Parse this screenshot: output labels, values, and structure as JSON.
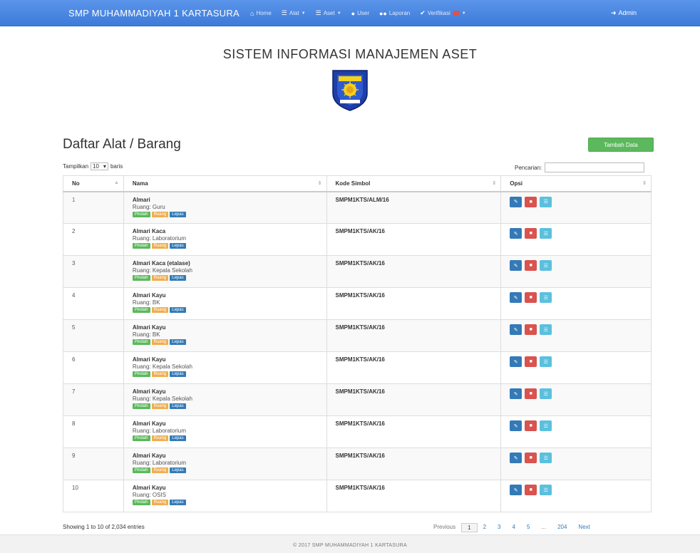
{
  "navbar": {
    "brand": "SMP MUHAMMADIYAH 1 KARTASURA",
    "items": [
      {
        "label": "Home",
        "icon": "home-icon"
      },
      {
        "label": "Alat",
        "icon": "list-icon"
      },
      {
        "label": "Aset",
        "icon": "list-icon"
      },
      {
        "label": "User",
        "icon": "user-icon"
      },
      {
        "label": "Laporan",
        "icon": "users-icon"
      },
      {
        "label": "Verifikasi",
        "icon": "check-icon"
      }
    ],
    "admin_label": "Admin"
  },
  "header": {
    "title": "SISTEM INFORMASI MANAJEMEN ASET"
  },
  "page": {
    "title": "Daftar Alat / Barang",
    "add_button": "Tambah Data"
  },
  "table_controls": {
    "length_prefix": "Tampilkan",
    "length_value": "10",
    "length_suffix": "baris",
    "search_label": "Pencarian:"
  },
  "columns": [
    "No",
    "Nama",
    "Kode Simbol",
    "Opsi"
  ],
  "tag_labels": {
    "pindah": "Pindah",
    "ruang": "Ruang",
    "lepas": "Lepas"
  },
  "rows": [
    {
      "no": "1",
      "name": "Almari",
      "room": "Ruang: Guru",
      "code": "SMPM1KTS/ALM/16"
    },
    {
      "no": "2",
      "name": "Almari Kaca",
      "room": "Ruang: Laboratorium",
      "code": "SMPM1KTS/AK/16"
    },
    {
      "no": "3",
      "name": "Almari Kaca (etalase)",
      "room": "Ruang: Kepala Sekolah",
      "code": "SMPM1KTS/AK/16"
    },
    {
      "no": "4",
      "name": "Almari Kayu",
      "room": "Ruang: BK",
      "code": "SMPM1KTS/AK/16"
    },
    {
      "no": "5",
      "name": "Almari Kayu",
      "room": "Ruang: BK",
      "code": "SMPM1KTS/AK/16"
    },
    {
      "no": "6",
      "name": "Almari Kayu",
      "room": "Ruang: Kepala Sekolah",
      "code": "SMPM1KTS/AK/16"
    },
    {
      "no": "7",
      "name": "Almari Kayu",
      "room": "Ruang: Kepala Sekolah",
      "code": "SMPM1KTS/AK/16"
    },
    {
      "no": "8",
      "name": "Almari Kayu",
      "room": "Ruang: Laboratorium",
      "code": "SMPM1KTS/AK/16"
    },
    {
      "no": "9",
      "name": "Almari Kayu",
      "room": "Ruang: Laboratorium",
      "code": "SMPM1KTS/AK/16"
    },
    {
      "no": "10",
      "name": "Almari Kayu",
      "room": "Ruang: OSIS",
      "code": "SMPM1KTS/AK/16"
    }
  ],
  "pagination": {
    "info": "Showing 1 to 10 of 2,034 entries",
    "previous": "Previous",
    "pages": [
      "1",
      "2",
      "3",
      "4",
      "5",
      "...",
      "204"
    ],
    "next": "Next"
  },
  "footer": {
    "text": "© 2017 SMP MUHAMMADIYAH 1 KARTASURA"
  }
}
